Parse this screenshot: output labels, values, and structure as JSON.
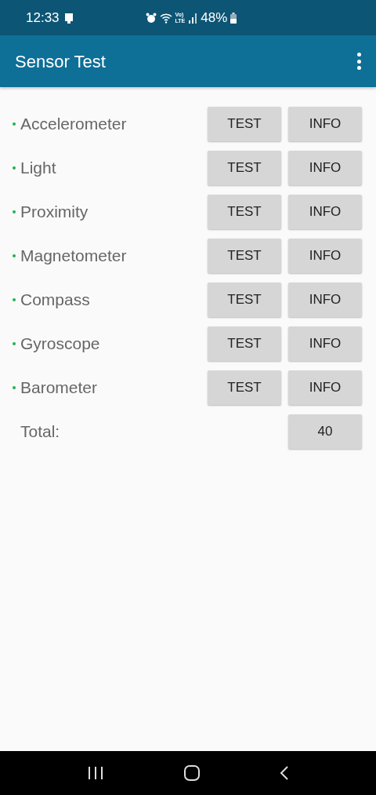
{
  "status_bar": {
    "time": "12:33",
    "volte_top": "Vo)",
    "volte_bottom": "LTE",
    "battery": "48%"
  },
  "app_bar": {
    "title": "Sensor Test"
  },
  "sensors": [
    {
      "name": "Accelerometer",
      "available": true,
      "test": "TEST",
      "info": "INFO"
    },
    {
      "name": "Light",
      "available": true,
      "test": "TEST",
      "info": "INFO"
    },
    {
      "name": "Proximity",
      "available": true,
      "test": "TEST",
      "info": "INFO"
    },
    {
      "name": "Magnetometer",
      "available": true,
      "test": "TEST",
      "info": "INFO"
    },
    {
      "name": "Compass",
      "available": true,
      "test": "TEST",
      "info": "INFO"
    },
    {
      "name": "Gyroscope",
      "available": true,
      "test": "TEST",
      "info": "INFO"
    },
    {
      "name": "Barometer",
      "available": true,
      "test": "TEST",
      "info": "INFO"
    }
  ],
  "total": {
    "label": "Total:",
    "value": "40"
  }
}
